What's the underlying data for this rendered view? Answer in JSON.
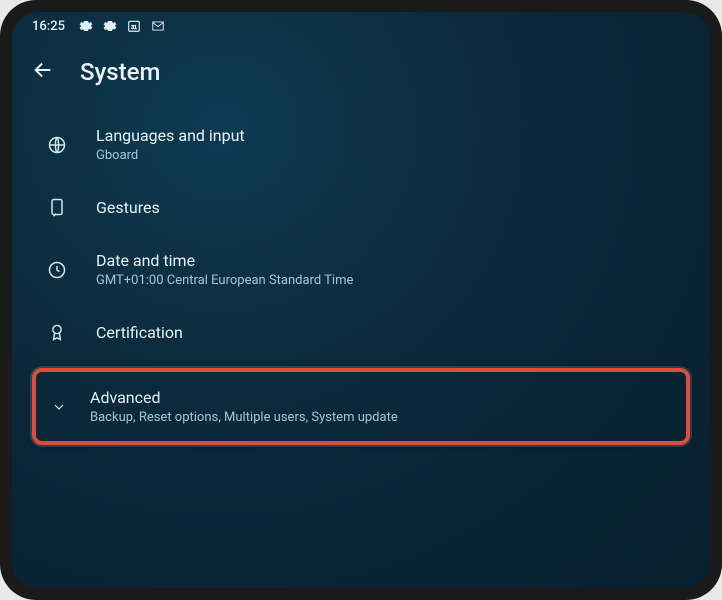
{
  "status": {
    "time": "16:25"
  },
  "header": {
    "title": "System"
  },
  "items": {
    "languages": {
      "label": "Languages and input",
      "sub": "Gboard"
    },
    "gestures": {
      "label": "Gestures"
    },
    "datetime": {
      "label": "Date and time",
      "sub": "GMT+01:00 Central European Standard Time"
    },
    "certification": {
      "label": "Certification"
    },
    "advanced": {
      "label": "Advanced",
      "sub": "Backup, Reset options, Multiple users, System update"
    }
  }
}
